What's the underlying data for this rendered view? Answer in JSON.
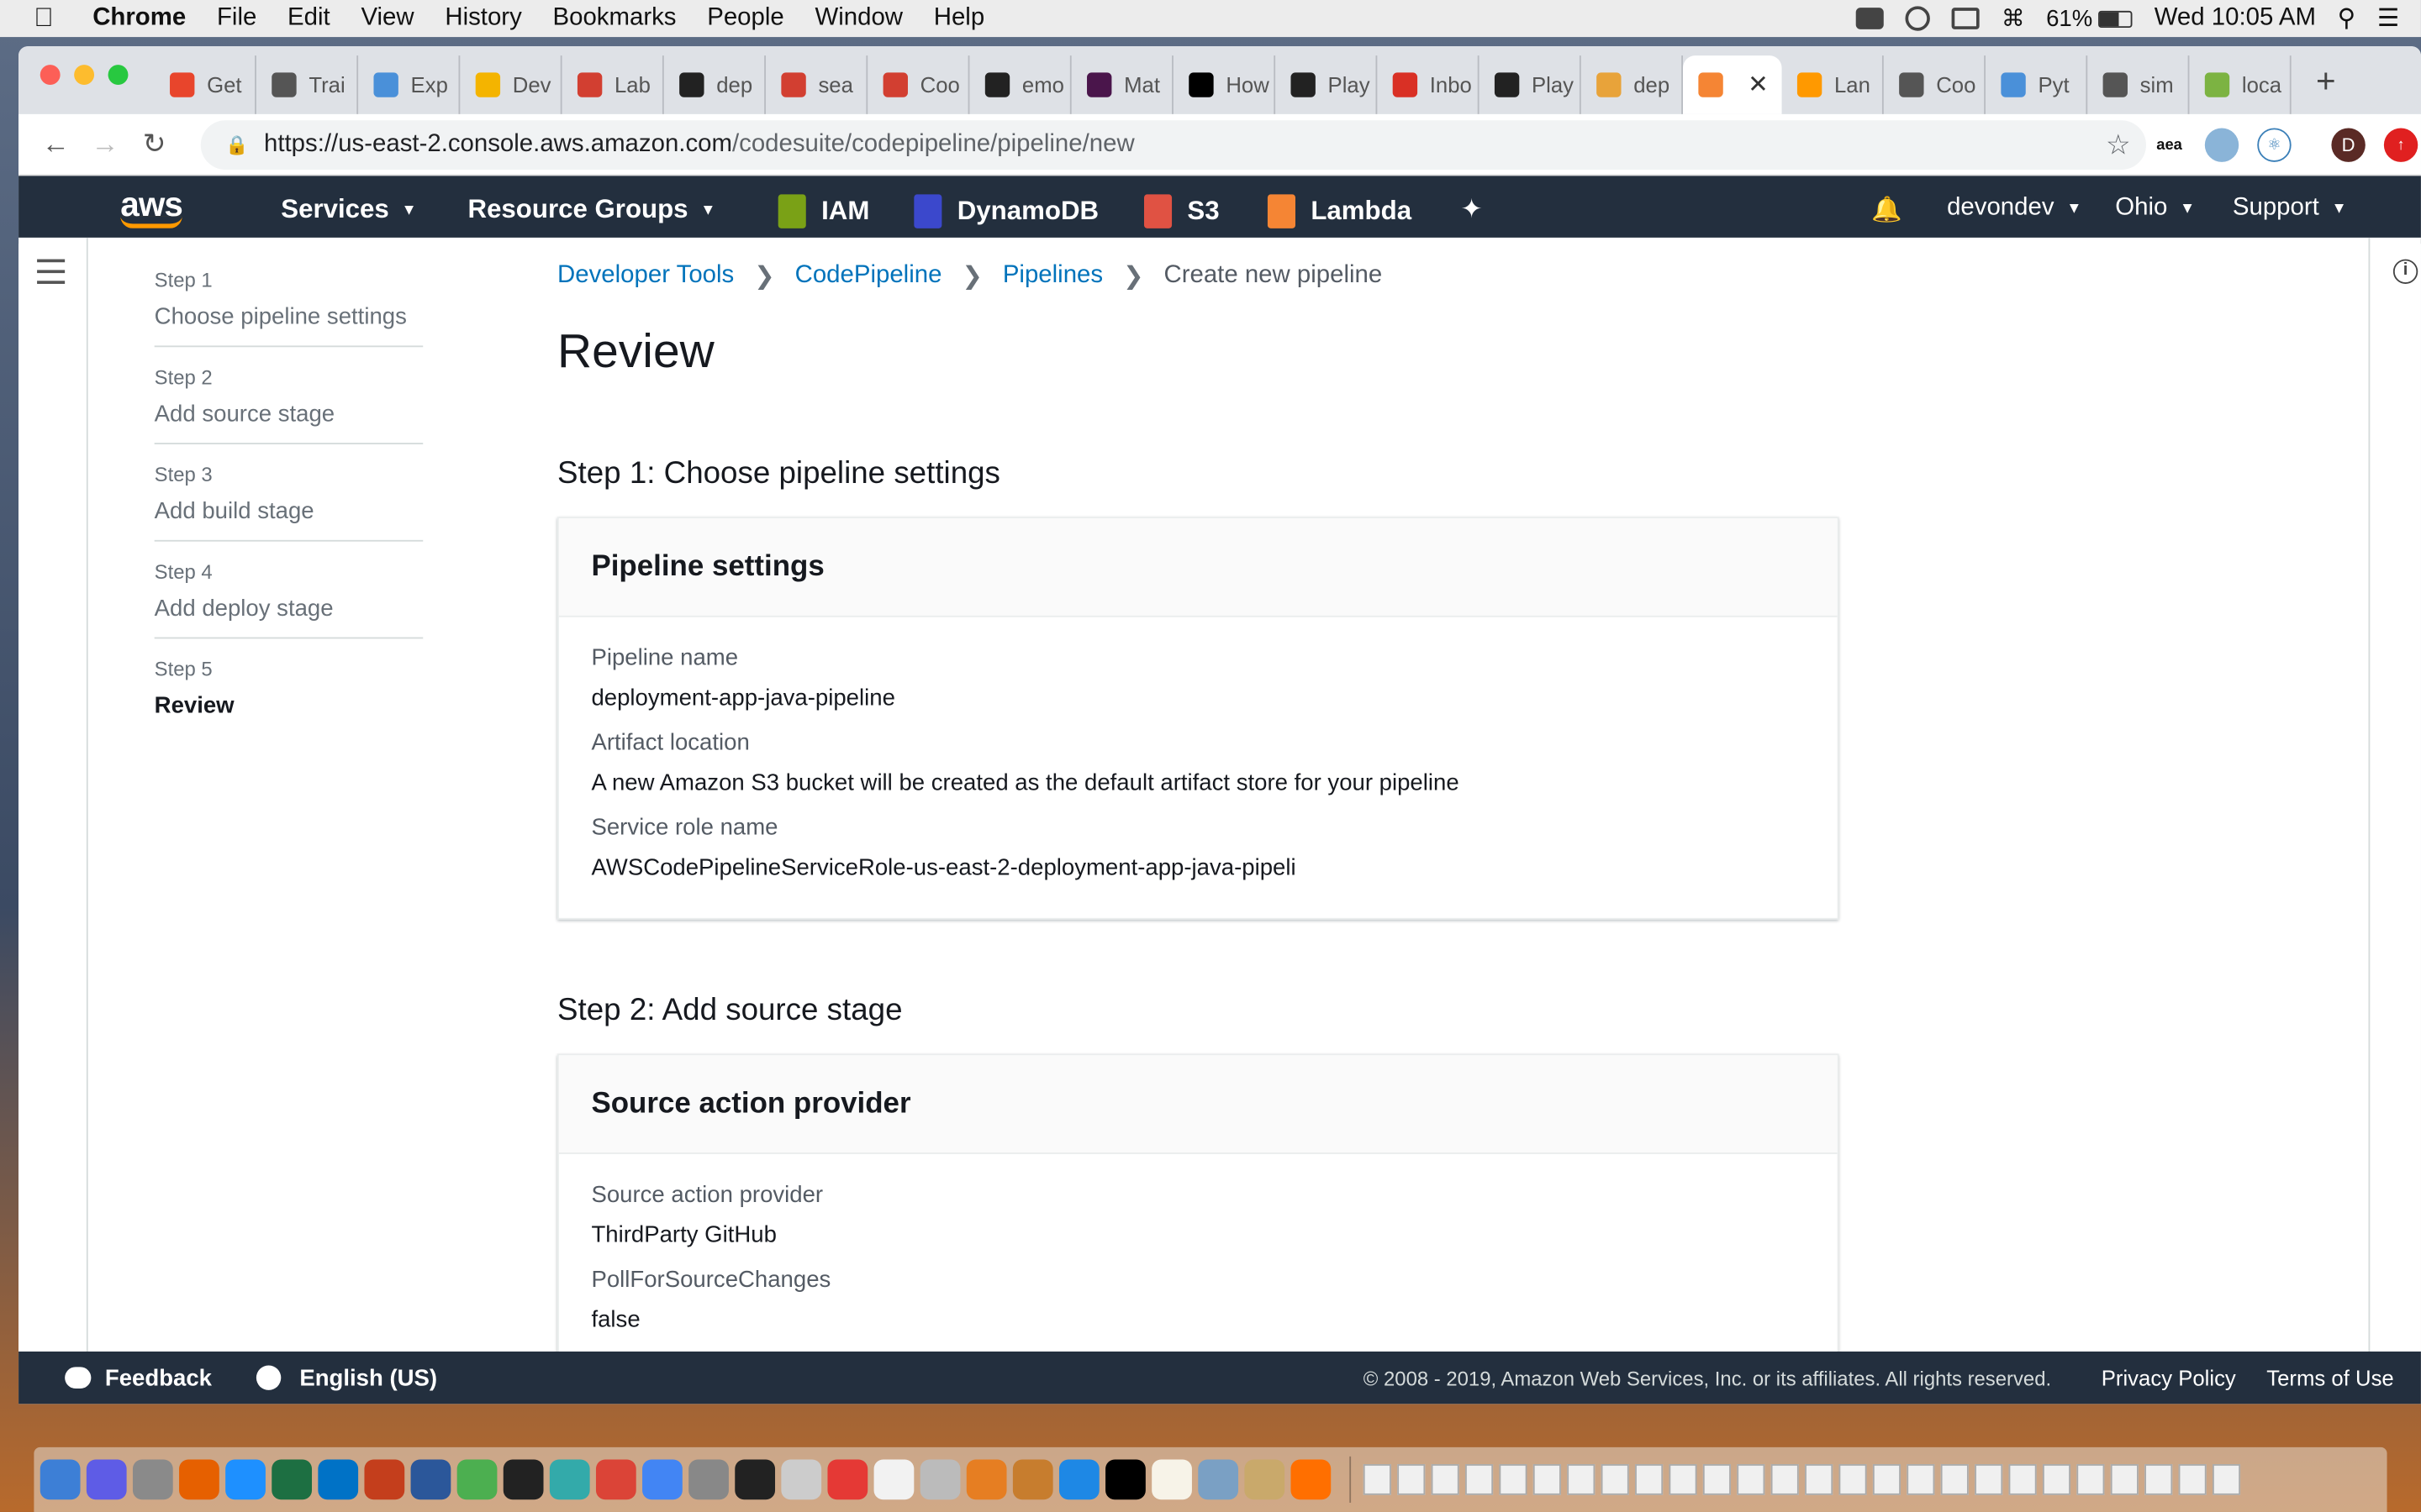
{
  "menubar": {
    "app_name": "Chrome",
    "items": [
      "File",
      "Edit",
      "View",
      "History",
      "Bookmarks",
      "People",
      "Window",
      "Help"
    ],
    "battery": "61%",
    "clock": "Wed 10:05 AM"
  },
  "browser": {
    "tabs": [
      {
        "label": "Get",
        "color": "#e8452c"
      },
      {
        "label": "Trai",
        "color": "#555555"
      },
      {
        "label": "Exp",
        "color": "#4a90d9"
      },
      {
        "label": "Dev",
        "color": "#f4b400"
      },
      {
        "label": "Lab",
        "color": "#d23f31"
      },
      {
        "label": "dep",
        "color": "#222222"
      },
      {
        "label": "sea",
        "color": "#d23f31"
      },
      {
        "label": "Coo",
        "color": "#d23f31"
      },
      {
        "label": "emo",
        "color": "#222222"
      },
      {
        "label": "Mat",
        "color": "#4a154b"
      },
      {
        "label": "How",
        "color": "#000000"
      },
      {
        "label": "Play",
        "color": "#222222"
      },
      {
        "label": "Inbo",
        "color": "#d93025"
      },
      {
        "label": "Play",
        "color": "#222222"
      },
      {
        "label": "dep",
        "color": "#e8a33a"
      },
      {
        "label": "",
        "color": "#f58534",
        "active": true
      },
      {
        "label": "Lan",
        "color": "#ff9900"
      },
      {
        "label": "Coo",
        "color": "#555555"
      },
      {
        "label": "Pyt",
        "color": "#4a90d9"
      },
      {
        "label": "sim",
        "color": "#555555"
      },
      {
        "label": "loca",
        "color": "#7cb342"
      }
    ],
    "url_host": "https://us-east-2.console.aws.amazon.com",
    "url_path": "/codesuite/codepipeline/pipeline/new",
    "profile_initial": "D"
  },
  "aws_nav": {
    "logo_text": "aws",
    "services": "Services",
    "resource_groups": "Resource Groups",
    "shortcuts": [
      {
        "label": "IAM",
        "color": "#7aa116"
      },
      {
        "label": "DynamoDB",
        "color": "#3b48cc"
      },
      {
        "label": "S3",
        "color": "#e05243"
      },
      {
        "label": "Lambda",
        "color": "#f58534"
      }
    ],
    "account": "devondev",
    "region": "Ohio",
    "support": "Support"
  },
  "wizard": {
    "steps": [
      {
        "num": "Step 1",
        "title": "Choose pipeline settings"
      },
      {
        "num": "Step 2",
        "title": "Add source stage"
      },
      {
        "num": "Step 3",
        "title": "Add build stage"
      },
      {
        "num": "Step 4",
        "title": "Add deploy stage"
      },
      {
        "num": "Step 5",
        "title": "Review",
        "current": true
      }
    ]
  },
  "breadcrumb": {
    "items": [
      "Developer Tools",
      "CodePipeline",
      "Pipelines"
    ],
    "current": "Create new pipeline"
  },
  "page": {
    "title": "Review",
    "section1": {
      "heading": "Step 1: Choose pipeline settings",
      "panel_title": "Pipeline settings",
      "fields": [
        {
          "label": "Pipeline name",
          "value": "deployment-app-java-pipeline"
        },
        {
          "label": "Artifact location",
          "value": "A new Amazon S3 bucket will be created as the default artifact store for your pipeline"
        },
        {
          "label": "Service role name",
          "value": "AWSCodePipelineServiceRole-us-east-2-deployment-app-java-pipeli"
        }
      ]
    },
    "section2": {
      "heading": "Step 2: Add source stage",
      "panel_title": "Source action provider",
      "fields": [
        {
          "label": "Source action provider",
          "value": "ThirdParty GitHub"
        },
        {
          "label": "PollForSourceChanges",
          "value": "false"
        }
      ]
    }
  },
  "footer": {
    "feedback": "Feedback",
    "language": "English (US)",
    "copyright": "© 2008 - 2019, Amazon Web Services, Inc. or its affiliates. All rights reserved.",
    "privacy": "Privacy Policy",
    "terms": "Terms of Use"
  }
}
